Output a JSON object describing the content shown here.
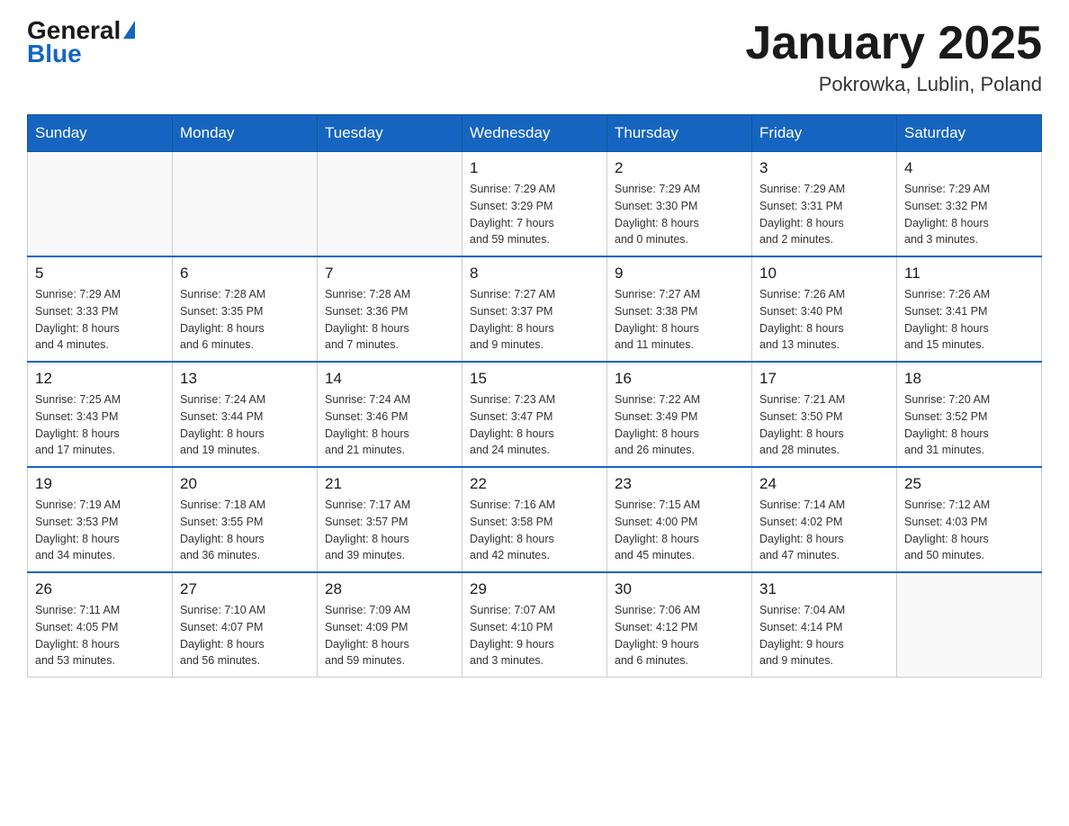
{
  "header": {
    "logo_general": "General",
    "logo_blue": "Blue",
    "month_title": "January 2025",
    "location": "Pokrowka, Lublin, Poland"
  },
  "calendar": {
    "days_of_week": [
      "Sunday",
      "Monday",
      "Tuesday",
      "Wednesday",
      "Thursday",
      "Friday",
      "Saturday"
    ],
    "weeks": [
      [
        {
          "day": "",
          "info": ""
        },
        {
          "day": "",
          "info": ""
        },
        {
          "day": "",
          "info": ""
        },
        {
          "day": "1",
          "info": "Sunrise: 7:29 AM\nSunset: 3:29 PM\nDaylight: 7 hours\nand 59 minutes."
        },
        {
          "day": "2",
          "info": "Sunrise: 7:29 AM\nSunset: 3:30 PM\nDaylight: 8 hours\nand 0 minutes."
        },
        {
          "day": "3",
          "info": "Sunrise: 7:29 AM\nSunset: 3:31 PM\nDaylight: 8 hours\nand 2 minutes."
        },
        {
          "day": "4",
          "info": "Sunrise: 7:29 AM\nSunset: 3:32 PM\nDaylight: 8 hours\nand 3 minutes."
        }
      ],
      [
        {
          "day": "5",
          "info": "Sunrise: 7:29 AM\nSunset: 3:33 PM\nDaylight: 8 hours\nand 4 minutes."
        },
        {
          "day": "6",
          "info": "Sunrise: 7:28 AM\nSunset: 3:35 PM\nDaylight: 8 hours\nand 6 minutes."
        },
        {
          "day": "7",
          "info": "Sunrise: 7:28 AM\nSunset: 3:36 PM\nDaylight: 8 hours\nand 7 minutes."
        },
        {
          "day": "8",
          "info": "Sunrise: 7:27 AM\nSunset: 3:37 PM\nDaylight: 8 hours\nand 9 minutes."
        },
        {
          "day": "9",
          "info": "Sunrise: 7:27 AM\nSunset: 3:38 PM\nDaylight: 8 hours\nand 11 minutes."
        },
        {
          "day": "10",
          "info": "Sunrise: 7:26 AM\nSunset: 3:40 PM\nDaylight: 8 hours\nand 13 minutes."
        },
        {
          "day": "11",
          "info": "Sunrise: 7:26 AM\nSunset: 3:41 PM\nDaylight: 8 hours\nand 15 minutes."
        }
      ],
      [
        {
          "day": "12",
          "info": "Sunrise: 7:25 AM\nSunset: 3:43 PM\nDaylight: 8 hours\nand 17 minutes."
        },
        {
          "day": "13",
          "info": "Sunrise: 7:24 AM\nSunset: 3:44 PM\nDaylight: 8 hours\nand 19 minutes."
        },
        {
          "day": "14",
          "info": "Sunrise: 7:24 AM\nSunset: 3:46 PM\nDaylight: 8 hours\nand 21 minutes."
        },
        {
          "day": "15",
          "info": "Sunrise: 7:23 AM\nSunset: 3:47 PM\nDaylight: 8 hours\nand 24 minutes."
        },
        {
          "day": "16",
          "info": "Sunrise: 7:22 AM\nSunset: 3:49 PM\nDaylight: 8 hours\nand 26 minutes."
        },
        {
          "day": "17",
          "info": "Sunrise: 7:21 AM\nSunset: 3:50 PM\nDaylight: 8 hours\nand 28 minutes."
        },
        {
          "day": "18",
          "info": "Sunrise: 7:20 AM\nSunset: 3:52 PM\nDaylight: 8 hours\nand 31 minutes."
        }
      ],
      [
        {
          "day": "19",
          "info": "Sunrise: 7:19 AM\nSunset: 3:53 PM\nDaylight: 8 hours\nand 34 minutes."
        },
        {
          "day": "20",
          "info": "Sunrise: 7:18 AM\nSunset: 3:55 PM\nDaylight: 8 hours\nand 36 minutes."
        },
        {
          "day": "21",
          "info": "Sunrise: 7:17 AM\nSunset: 3:57 PM\nDaylight: 8 hours\nand 39 minutes."
        },
        {
          "day": "22",
          "info": "Sunrise: 7:16 AM\nSunset: 3:58 PM\nDaylight: 8 hours\nand 42 minutes."
        },
        {
          "day": "23",
          "info": "Sunrise: 7:15 AM\nSunset: 4:00 PM\nDaylight: 8 hours\nand 45 minutes."
        },
        {
          "day": "24",
          "info": "Sunrise: 7:14 AM\nSunset: 4:02 PM\nDaylight: 8 hours\nand 47 minutes."
        },
        {
          "day": "25",
          "info": "Sunrise: 7:12 AM\nSunset: 4:03 PM\nDaylight: 8 hours\nand 50 minutes."
        }
      ],
      [
        {
          "day": "26",
          "info": "Sunrise: 7:11 AM\nSunset: 4:05 PM\nDaylight: 8 hours\nand 53 minutes."
        },
        {
          "day": "27",
          "info": "Sunrise: 7:10 AM\nSunset: 4:07 PM\nDaylight: 8 hours\nand 56 minutes."
        },
        {
          "day": "28",
          "info": "Sunrise: 7:09 AM\nSunset: 4:09 PM\nDaylight: 8 hours\nand 59 minutes."
        },
        {
          "day": "29",
          "info": "Sunrise: 7:07 AM\nSunset: 4:10 PM\nDaylight: 9 hours\nand 3 minutes."
        },
        {
          "day": "30",
          "info": "Sunrise: 7:06 AM\nSunset: 4:12 PM\nDaylight: 9 hours\nand 6 minutes."
        },
        {
          "day": "31",
          "info": "Sunrise: 7:04 AM\nSunset: 4:14 PM\nDaylight: 9 hours\nand 9 minutes."
        },
        {
          "day": "",
          "info": ""
        }
      ]
    ]
  }
}
